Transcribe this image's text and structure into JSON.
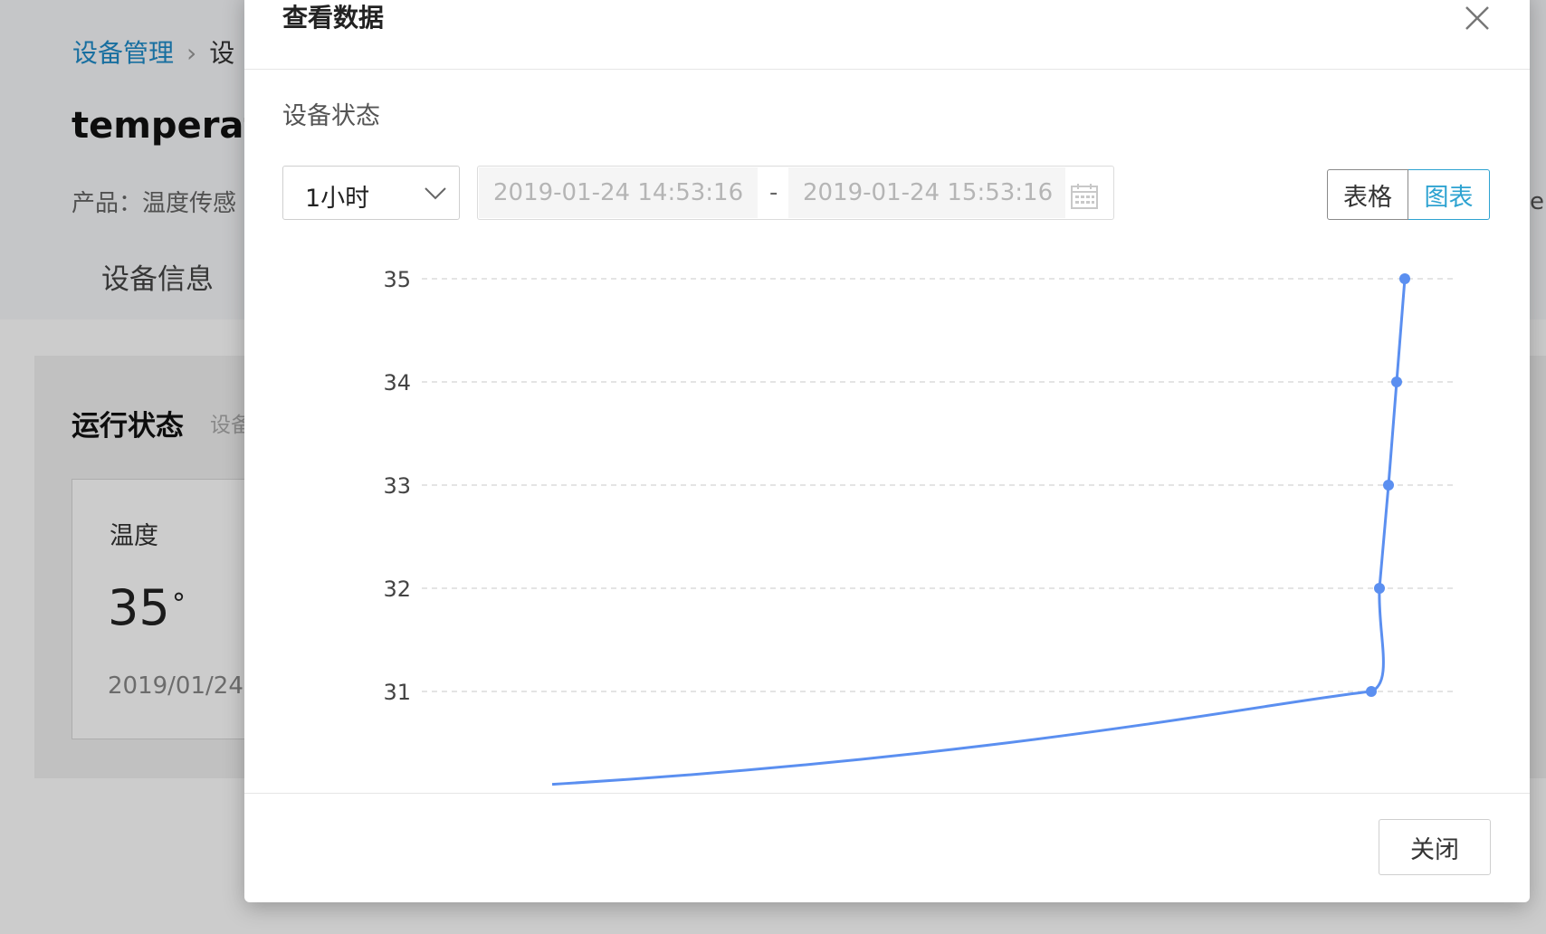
{
  "background": {
    "breadcrumb": {
      "root": "设备管理",
      "current": "设"
    },
    "device_name": "temperatu",
    "product_line": "产品：温度传感",
    "tab_info": "设备信息",
    "run_status_title": "运行状态",
    "run_status_sub": "设备",
    "temperature": {
      "label": "温度",
      "value": "35",
      "unit": "°",
      "date": "2019/01/24"
    },
    "edge_text": "e"
  },
  "modal": {
    "title": "查看数据",
    "close_icon": "close-icon",
    "section_label": "设备状态",
    "range_select": {
      "value": "1小时",
      "icon": "chevron-down-icon"
    },
    "date_range": {
      "start": "2019-01-24 14:53:16",
      "separator": "-",
      "end": "2019-01-24 15:53:16",
      "icon": "calendar-icon"
    },
    "view_toggle": {
      "table_label": "表格",
      "chart_label": "图表",
      "active": "chart"
    },
    "footer": {
      "close_label": "关闭"
    },
    "colors": {
      "accent": "#2ea3d1",
      "line": "#5b8ff0"
    }
  },
  "chart_data": {
    "type": "line",
    "title": "",
    "xlabel": "",
    "ylabel": "",
    "y_ticks": [
      "31",
      "32",
      "33",
      "34",
      "35"
    ],
    "ylim": [
      30.1,
      35
    ],
    "grid": true,
    "series": [
      {
        "values": [
          30.1,
          31,
          32,
          33,
          34,
          35
        ]
      }
    ]
  }
}
